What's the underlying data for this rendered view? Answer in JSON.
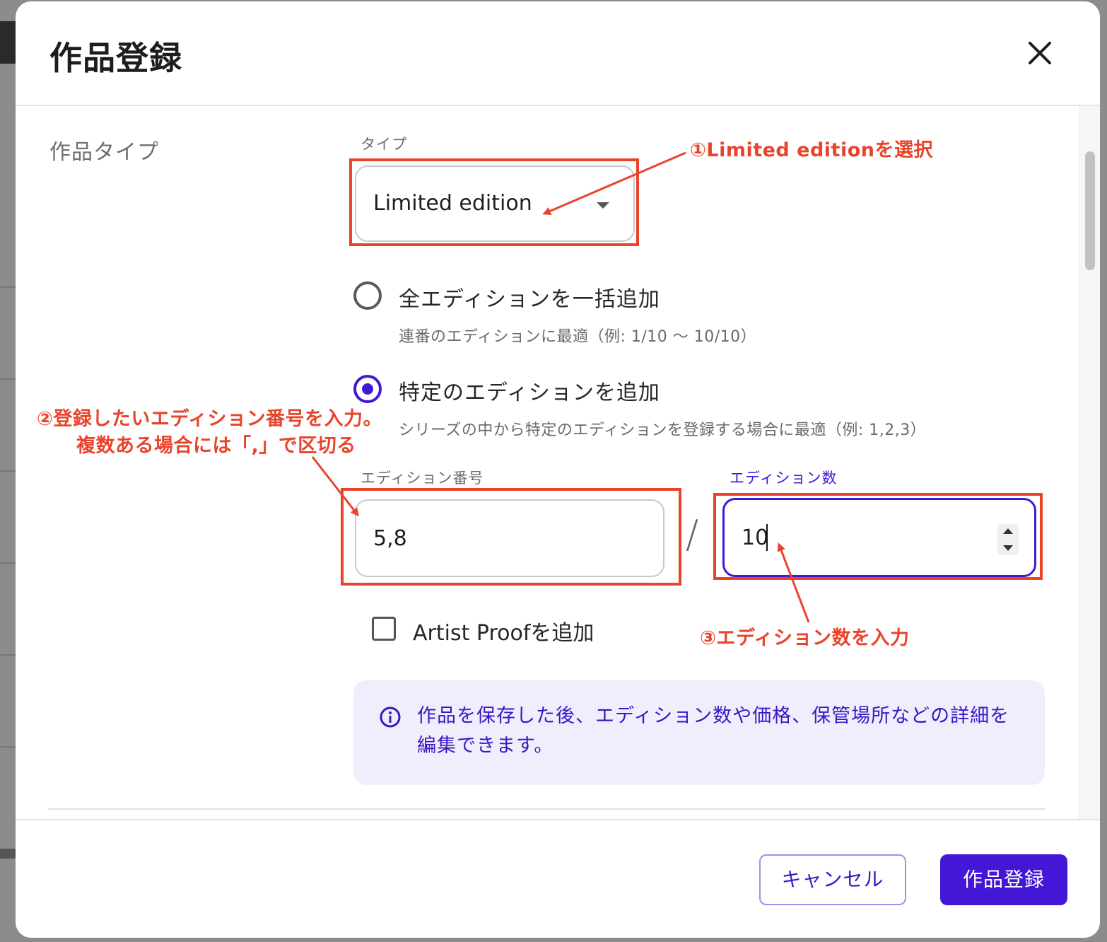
{
  "modal": {
    "title": "作品登録",
    "close_icon": "close-icon"
  },
  "form": {
    "section_label": "作品タイプ",
    "type": {
      "label": "タイプ",
      "value": "Limited edition"
    },
    "options": [
      {
        "label": "全エディションを一括追加",
        "description": "連番のエディションに最適（例: 1/10 〜 10/10）",
        "selected": false
      },
      {
        "label": "特定のエディションを追加",
        "description": "シリーズの中から特定のエディションを登録する場合に最適（例: 1,2,3）",
        "selected": true
      }
    ],
    "edition_number": {
      "label": "エディション番号",
      "value": "5,8"
    },
    "separator": "/",
    "edition_count": {
      "label": "エディション数",
      "value": "10"
    },
    "artist_proof": {
      "label": "Artist Proofを追加",
      "checked": false
    },
    "info": {
      "icon": "info-icon",
      "text": "作品を保存した後、エディション数や価格、保管場所などの詳細を編集できます。"
    }
  },
  "footer": {
    "cancel_label": "キャンセル",
    "submit_label": "作品登録"
  },
  "annotations": {
    "step1": "①Limited editionを選択",
    "step2_line1": "②登録したいエディション番号を入力。",
    "step2_line2": "複数ある場合には「,」で区切る",
    "step3": "③エディション数を入力"
  },
  "colors": {
    "accent": "#4417d6",
    "annotation": "#e9442b",
    "info_background": "#efeefc"
  }
}
